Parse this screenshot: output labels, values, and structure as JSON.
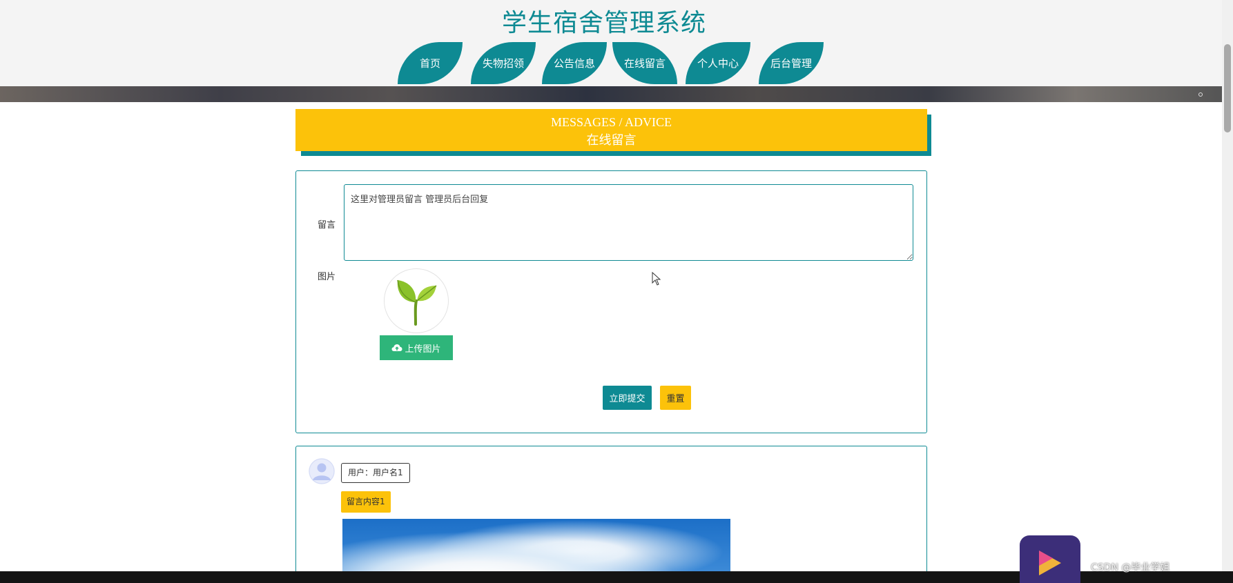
{
  "header": {
    "site_title": "学生宿舍管理系统",
    "nav": [
      "首页",
      "失物招领",
      "公告信息",
      "在线留言",
      "个人中心",
      "后台管理"
    ],
    "active_nav": "在线留言"
  },
  "section": {
    "title_en": "MESSAGES / ADVICE",
    "title_cn": "在线留言"
  },
  "form": {
    "message_label": "留言",
    "message_value": "这里对管理员留言 管理员后台回复",
    "image_label": "图片",
    "upload_label": "上传图片",
    "submit_label": "立即提交",
    "reset_label": "重置"
  },
  "messages": [
    {
      "user": "用户：用户名1",
      "content": "留言内容1"
    }
  ],
  "watermark": "CSDN @毕业学姐",
  "colors": {
    "primary": "#0e8a93",
    "accent": "#fcc20a",
    "upload": "#2eb57a"
  },
  "icons": {
    "upload": "cloud-upload-icon",
    "placeholder": "sprout-icon",
    "avatar": "user-avatar-icon"
  }
}
